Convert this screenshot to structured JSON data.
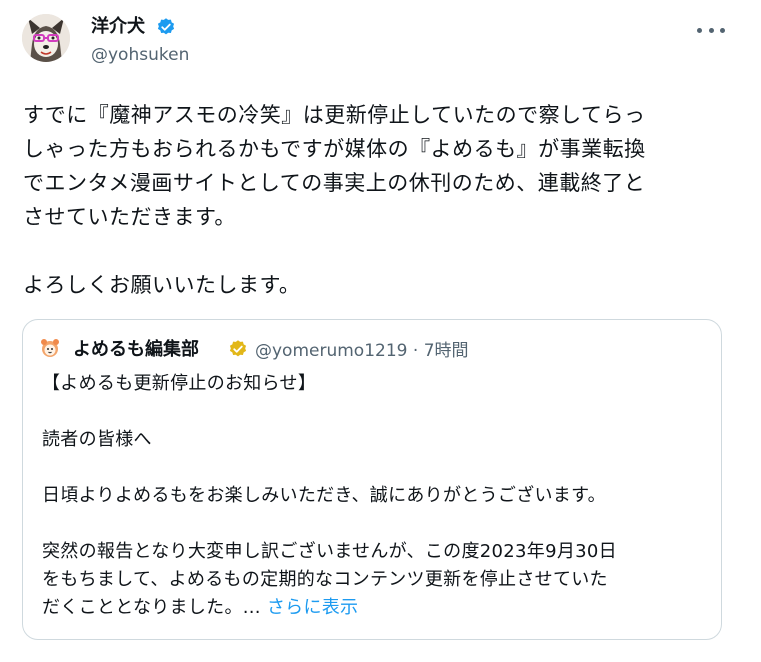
{
  "author": {
    "display_name": "洋介犬",
    "handle": "@yohsuken",
    "avatar_icon": "dog-avatar-icon",
    "verified_color": "#1d9bf0"
  },
  "tweet": {
    "text": "すでに『魔神アスモの冷笑』は更新停止していたので察してらっ\nしゃった方もおられるかもですが媒体の『よめるも』が事業転換\nでエンタメ漫画サイトとしての事実上の休刊のため、連載終了と\nさせていただきます。\n\nよろしくお願いいたします。"
  },
  "quoted": {
    "display_name": "よめるも編集部",
    "handle": "@yomerumo1219",
    "separator": "·",
    "time": "7時間",
    "verified_color": "#e2b719",
    "text": "【よめるも更新停止のお知らせ】\n\n読者の皆様へ\n\n日頃よりよめるもをお楽しみいただき、誠にありがとうございます。\n\n突然の報告となり大変申し訳ございませんが、この度2023年9月30日\nをもちまして、よめるもの定期的なコンテンツ更新を停止させていた\nだくこととなりました。... ",
    "show_more": "さらに表示"
  },
  "colors": {
    "text": "#0f1419",
    "secondary": "#536471",
    "link": "#1d9bf0",
    "border": "#cfd9de"
  }
}
